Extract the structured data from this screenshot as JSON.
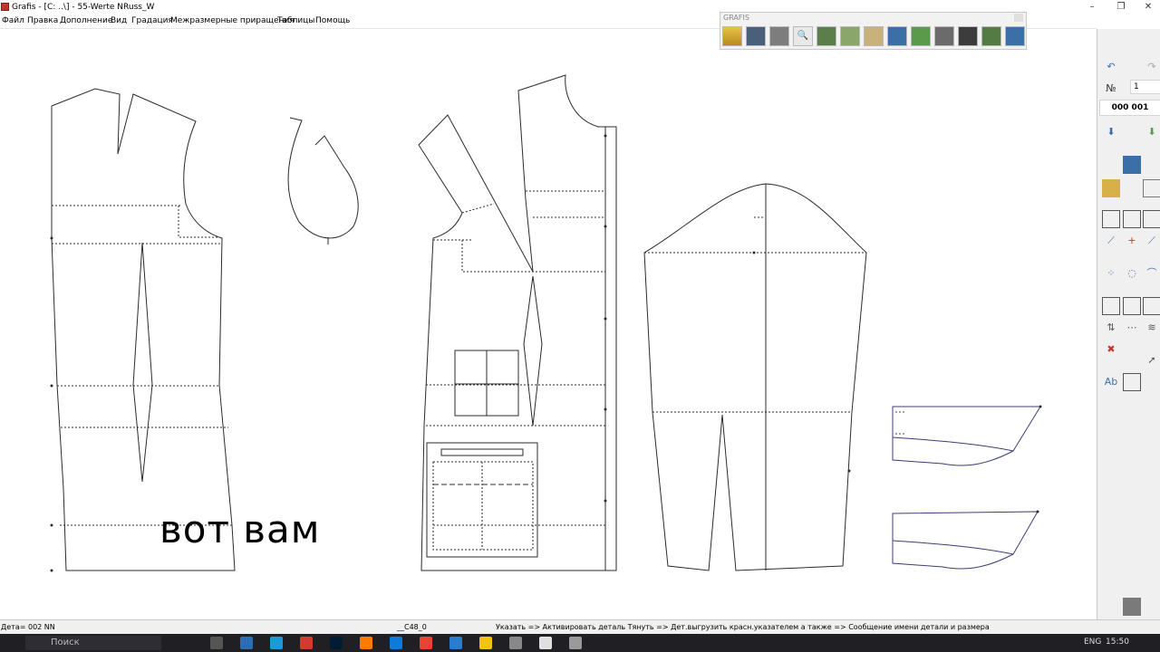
{
  "window": {
    "title": "Grafis - [C: ..\\] - 55-Werte NRuss_W"
  },
  "menu": [
    "Файл",
    "Правка",
    "Дополнение",
    "Вид",
    "Градация",
    "Межразмерные приращения",
    "Таблицы",
    "Помощь"
  ],
  "toolbar": {
    "title": "GRAFIS",
    "buttons": [
      "open-icon",
      "save-icon",
      "print-icon",
      "zoom-icon",
      "f6-icon",
      "copy-icon",
      "measure-icon",
      "download-icon",
      "download-alt-icon",
      "grid-icon",
      "excel-icon",
      "f11-icon",
      "f12-icon"
    ]
  },
  "right_panel": {
    "number_field": "1",
    "code": "000 001"
  },
  "overlay": {
    "caption": "вот вам"
  },
  "status": {
    "detail": "Дета= 002  NN",
    "size": "__C48_0",
    "hint": "Указать => Активировать деталь Тянуть => Дет.выгрузить красн.указателем а также => Сообщение имени детали и размера"
  },
  "taskbar": {
    "search": "Поиск",
    "lang": "ENG",
    "time": "15:50"
  },
  "colors": {
    "pattern_line": "#2b2b2b",
    "cuff_line": "#3d3d7a",
    "panel_bg": "#f0f0f0"
  }
}
